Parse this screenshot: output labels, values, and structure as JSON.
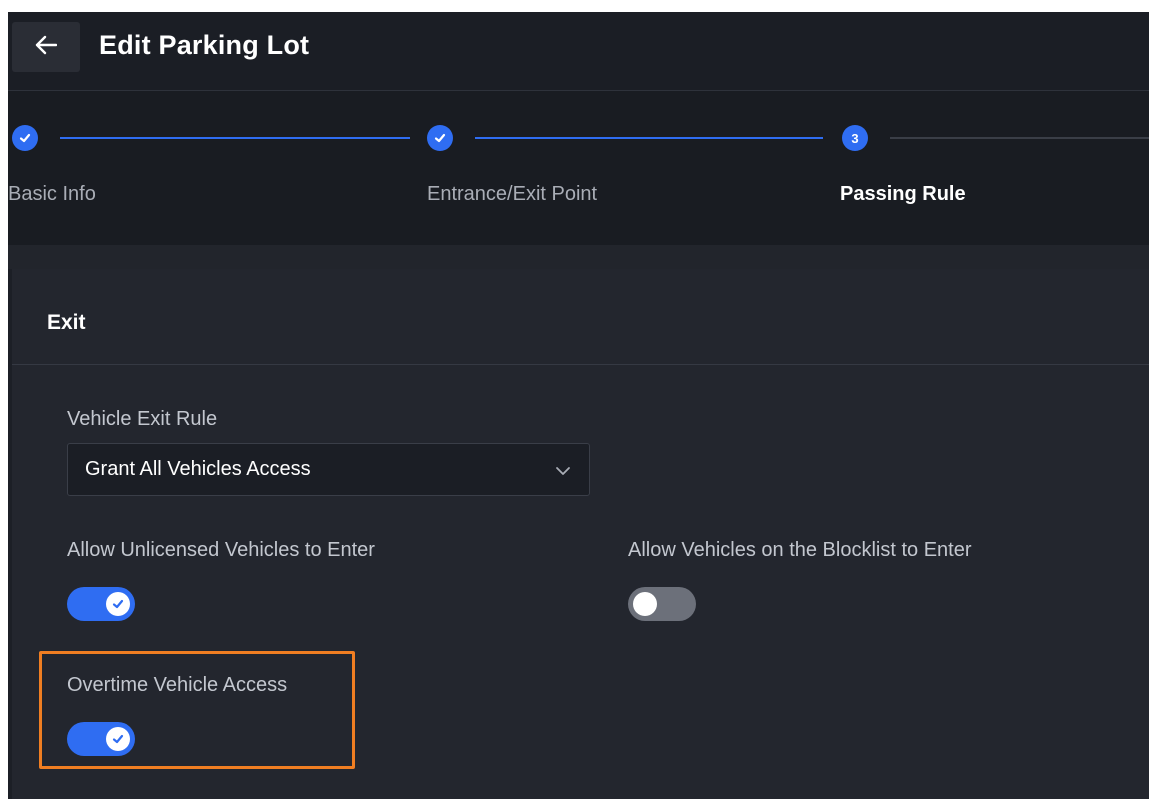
{
  "header": {
    "title": "Edit Parking Lot",
    "back_icon": "arrow-left-icon"
  },
  "stepper": {
    "steps": [
      {
        "number": "1",
        "label": "Basic Info",
        "status": "completed"
      },
      {
        "number": "2",
        "label": "Entrance/Exit Point",
        "status": "completed"
      },
      {
        "number": "3",
        "label": "Passing Rule",
        "status": "active"
      }
    ]
  },
  "section": {
    "title": "Exit"
  },
  "form": {
    "exit_rule_label": "Vehicle Exit Rule",
    "exit_rule_value": "Grant All Vehicles Access",
    "unlicensed_label": "Allow Unlicensed Vehicles to Enter",
    "unlicensed_on": true,
    "blocklist_label": "Allow Vehicles on the Blocklist to Enter",
    "blocklist_on": false,
    "overtime_label": "Overtime Vehicle Access",
    "overtime_on": true
  },
  "colors": {
    "accent": "#2f6df2",
    "highlight": "#f07e22",
    "background": "#1c1f26"
  }
}
